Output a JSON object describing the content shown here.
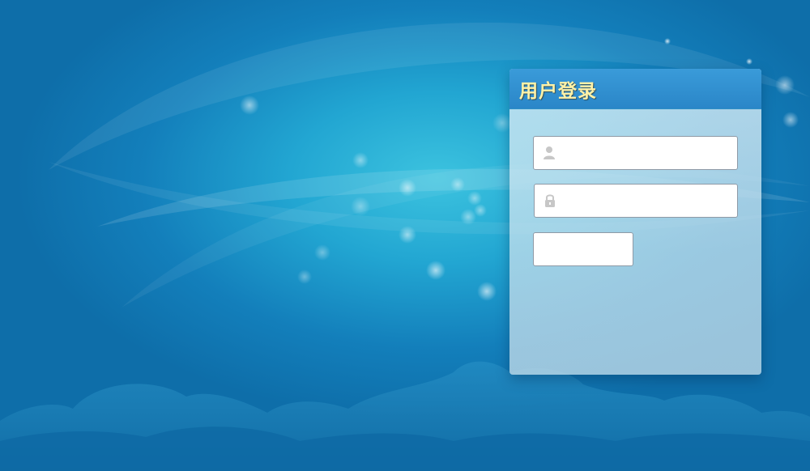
{
  "login": {
    "title": "用户登录",
    "username": {
      "value": "",
      "placeholder": "",
      "icon": "user-icon"
    },
    "password": {
      "value": "",
      "placeholder": "",
      "icon": "lock-icon"
    },
    "submit_label": ""
  },
  "colors": {
    "header": "#2a86c8",
    "title_text": "#fff2a8",
    "background": "#137fbb"
  }
}
